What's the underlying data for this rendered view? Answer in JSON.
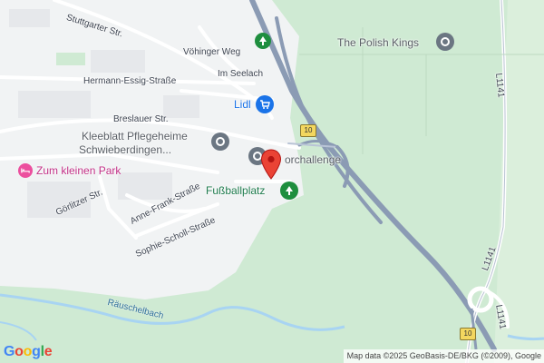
{
  "map": {
    "streets": {
      "stuttgarter": "Stuttgarter Str.",
      "vohinger": "Vöhinger Weg",
      "im_seelach": "Im Seelach",
      "hermann_essig": "Hermann-Essig-Straße",
      "breslauer": "Breslauer Str.",
      "gorlitzer": "Görlitzer Str.",
      "anne_frank": "Anne-Frank-Straße",
      "sophie_scholl": "Sophie-Scholl-Straße",
      "l1141_a": "L1141",
      "l1141_b": "L1141",
      "l1141_c": "L1141"
    },
    "pois": {
      "polish_kings": "The Polish Kings",
      "lidl": "Lidl",
      "kleeblatt_line1": "Kleeblatt Pflegeheime",
      "kleeblatt_line2": "Schwieberdingen...",
      "zum_kleinen_park": "Zum kleinen Park",
      "fussballplatz": "Fußballplatz",
      "challenge": "orchallenge"
    },
    "water": {
      "rauschelbach": "Räuschelbach"
    },
    "shields": {
      "top": "10",
      "bottom": "10"
    },
    "attribution": "Map data ©2025 GeoBasis-DE/BKG (©2009), Google",
    "logo": {
      "g1": "G",
      "o1": "o",
      "o2": "o",
      "g2": "g",
      "l": "l",
      "e": "e"
    },
    "icons": {
      "polish_kings": "place-icon",
      "lidl": "shopping-cart-icon",
      "kleeblatt": "place-icon",
      "park": "hotel-bed-icon",
      "fussballplatz": "park-icon",
      "tree": "tree-icon",
      "marker": "location-pin-icon"
    },
    "colors": {
      "land": "#e9efe6",
      "urban": "#f1f3f4",
      "green": "#cfead3",
      "highway": "#8b9bb4",
      "water": "#a8d4f2",
      "marker": "#ea4335"
    }
  }
}
